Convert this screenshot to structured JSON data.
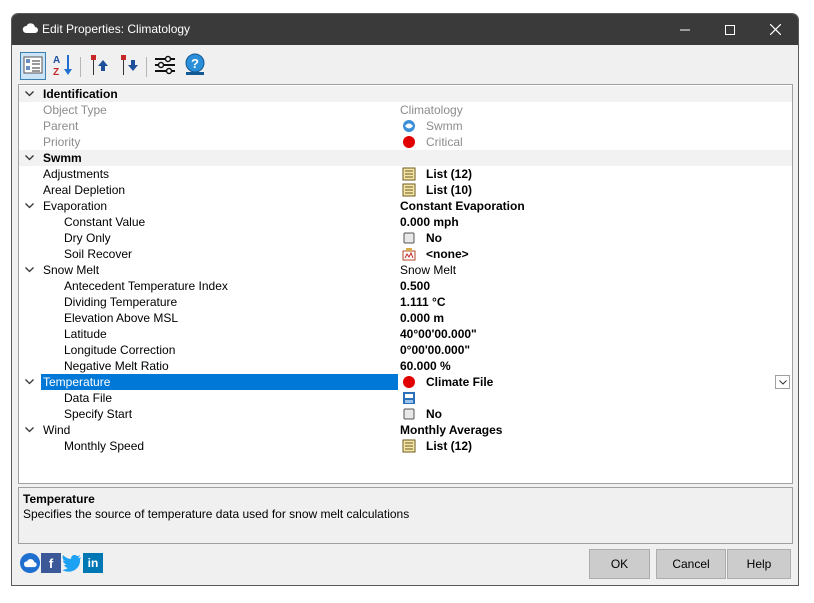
{
  "window": {
    "title": "Edit Properties: Climatology"
  },
  "titlebar_buttons": {
    "minimize": "─",
    "maximize": "☐",
    "close": "✕"
  },
  "toolbar": {
    "buttons": [
      {
        "name": "categorized-view-icon",
        "active": true
      },
      {
        "name": "sort-alphabetical-icon",
        "active": false
      },
      {
        "name": "move-up-icon",
        "active": false
      },
      {
        "name": "move-down-icon",
        "active": false
      },
      {
        "name": "settings-sliders-icon",
        "active": false
      },
      {
        "name": "help-icon",
        "active": false
      }
    ]
  },
  "grid": {
    "rows": [
      {
        "kind": "category",
        "name": "Identification",
        "expander": "chevron-down-icon"
      },
      {
        "kind": "prop",
        "indent": 1,
        "name": "Object Type",
        "value": "Climatology",
        "style": "gray"
      },
      {
        "kind": "prop",
        "indent": 1,
        "name": "Parent",
        "value": "Swmm",
        "style": "gray",
        "icon": "swmm-icon"
      },
      {
        "kind": "prop",
        "indent": 1,
        "name": "Priority",
        "value": "Critical",
        "style": "gray",
        "icon": "red-dot-icon"
      },
      {
        "kind": "category",
        "name": "Swmm",
        "expander": "chevron-down-icon"
      },
      {
        "kind": "prop",
        "indent": 1,
        "name": "Adjustments",
        "value": "List (12)",
        "style": "bold",
        "icon": "list-icon"
      },
      {
        "kind": "prop",
        "indent": 1,
        "name": "Areal Depletion",
        "value": "List (10)",
        "style": "bold",
        "icon": "list-icon"
      },
      {
        "kind": "group",
        "indent": 1,
        "name": "Evaporation",
        "value": "Constant Evaporation",
        "style": "bold",
        "expander": "chevron-down-icon"
      },
      {
        "kind": "prop",
        "indent": 2,
        "name": "Constant Value",
        "value": "0.000 mph",
        "style": "bold"
      },
      {
        "kind": "prop",
        "indent": 2,
        "name": "Dry Only",
        "value": "No",
        "style": "bold",
        "icon": "checkbox-icon"
      },
      {
        "kind": "prop",
        "indent": 2,
        "name": "Soil Recover",
        "value": "<none>",
        "style": "bold",
        "icon": "pattern-icon"
      },
      {
        "kind": "group",
        "indent": 1,
        "name": "Snow Melt",
        "value": "Snow Melt",
        "style": "normal",
        "expander": "chevron-down-icon"
      },
      {
        "kind": "prop",
        "indent": 2,
        "name": "Antecedent Temperature Index",
        "value": "0.500",
        "style": "bold"
      },
      {
        "kind": "prop",
        "indent": 2,
        "name": "Dividing Temperature",
        "value": "1.111 °C",
        "style": "bold"
      },
      {
        "kind": "prop",
        "indent": 2,
        "name": "Elevation Above MSL",
        "value": "0.000 m",
        "style": "bold"
      },
      {
        "kind": "prop",
        "indent": 2,
        "name": "Latitude",
        "value": "40°00'00.000\"",
        "style": "bold"
      },
      {
        "kind": "prop",
        "indent": 2,
        "name": "Longitude Correction",
        "value": "0°00'00.000\"",
        "style": "bold"
      },
      {
        "kind": "prop",
        "indent": 2,
        "name": "Negative Melt Ratio",
        "value": "60.000 %",
        "style": "bold"
      },
      {
        "kind": "group",
        "indent": 1,
        "name": "Temperature",
        "value": "Climate File",
        "style": "bold",
        "expander": "chevron-down-icon",
        "icon": "red-dot-icon",
        "selected": true
      },
      {
        "kind": "prop",
        "indent": 2,
        "name": "Data File",
        "value": "",
        "style": "bold",
        "icon": "data-file-icon"
      },
      {
        "kind": "prop",
        "indent": 2,
        "name": "Specify Start",
        "value": "No",
        "style": "bold",
        "icon": "checkbox-icon"
      },
      {
        "kind": "group",
        "indent": 1,
        "name": "Wind",
        "value": "Monthly Averages",
        "style": "bold",
        "expander": "chevron-down-icon"
      },
      {
        "kind": "prop",
        "indent": 2,
        "name": "Monthly Speed",
        "value": "List (12)",
        "style": "bold",
        "icon": "list-icon"
      }
    ]
  },
  "description": {
    "title": "Temperature",
    "text": "Specifies the source of temperature data used for snow melt calculations"
  },
  "social": {
    "facebook": "f",
    "linkedin": "in"
  },
  "buttons": {
    "ok": "OK",
    "cancel": "Cancel",
    "help": "Help"
  },
  "colors": {
    "selection": "#0078d7",
    "titlebar": "#3a3a3a",
    "critical": "#e00000"
  }
}
